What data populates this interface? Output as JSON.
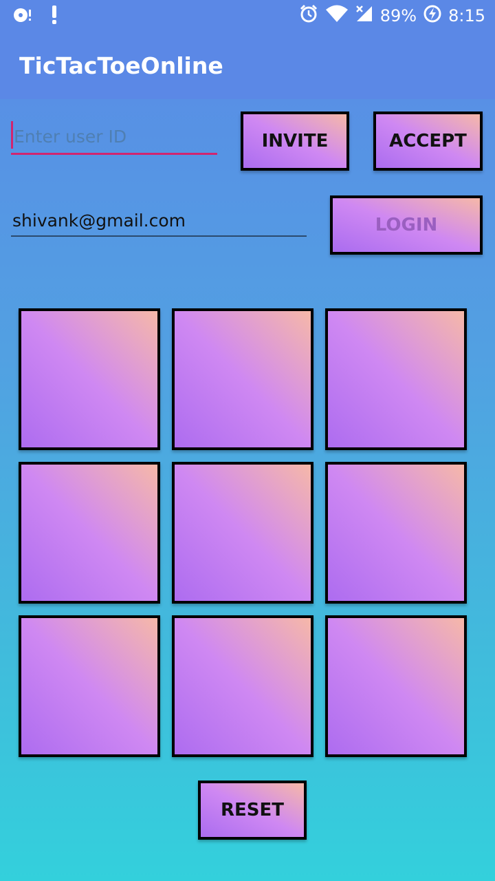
{
  "status_bar": {
    "battery": "89%",
    "time": "8:15",
    "icons": [
      "storage-notification-icon",
      "alert-icon",
      "alarm-icon",
      "wifi-icon",
      "cell-signal-icon",
      "battery-charging-icon"
    ]
  },
  "app_bar": {
    "title": "TicTacToeOnline"
  },
  "invite_section": {
    "user_id_placeholder": "Enter user ID",
    "invite_label": "INVITE",
    "accept_label": "ACCEPT"
  },
  "login_section": {
    "email_value": "shivank@gmail.com",
    "login_label": "LOGIN"
  },
  "board": {
    "cells": [
      "",
      "",
      "",
      "",
      "",
      "",
      "",
      "",
      ""
    ]
  },
  "reset_label": "RESET",
  "colors": {
    "primary": "#5b88e6",
    "accent": "#d1256f",
    "button_gradient_start": "#aa6cf0",
    "button_gradient_end": "#f6b8a8"
  }
}
